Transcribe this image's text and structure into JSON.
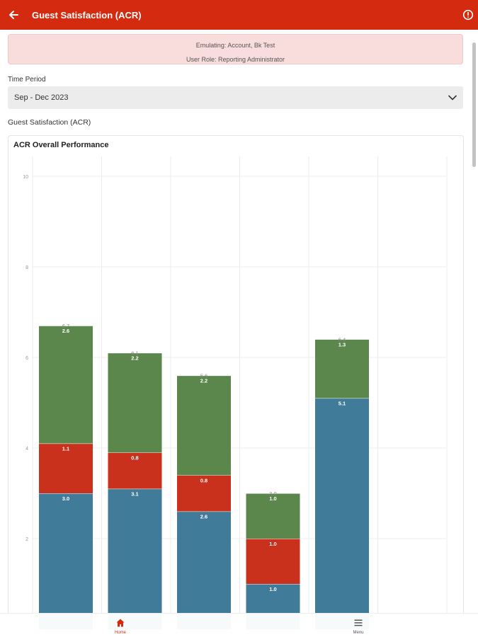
{
  "header": {
    "title": "Guest Satisfaction (ACR)",
    "back_icon": "arrow-left-icon",
    "info_icon": "info-icon"
  },
  "banner": {
    "emulating": "Emulating: Account, Bk Test",
    "role": "User Role: Reporting Administrator"
  },
  "filter": {
    "label": "Time Period",
    "value": "Sep - Dec 2023"
  },
  "section": {
    "title": "Guest Satisfaction (ACR)"
  },
  "chart_data": {
    "type": "bar",
    "stacked": true,
    "title": "ACR Overall Performance",
    "xlabel": "",
    "ylabel": "",
    "ylim": [
      0,
      10
    ],
    "yticks": [
      "10",
      "8",
      "6",
      "4",
      "2"
    ],
    "grid": true,
    "colors": {
      "series_blue": "#417b9a",
      "series_red": "#c9311c",
      "series_green": "#5b874c"
    },
    "series": [
      {
        "values": [
          3.0,
          3.1,
          2.6,
          1.0,
          5.1
        ],
        "labels": [
          "3.0",
          "3.1",
          "2.6",
          "1.0",
          "5.1"
        ]
      },
      {
        "values": [
          1.1,
          0.8,
          0.8,
          1.0,
          0
        ],
        "labels": [
          "1.1",
          "0.8",
          "0.8",
          "1.0",
          ""
        ]
      },
      {
        "values": [
          2.6,
          2.2,
          2.2,
          1.0,
          1.3
        ],
        "labels": [
          "2.6",
          "2.2",
          "2.2",
          "1.0",
          "1.3"
        ]
      }
    ],
    "totals": [
      "6.7",
      "6.1",
      "5.6",
      "3.0",
      "6.4"
    ]
  },
  "bottom_nav": {
    "home": {
      "label": "Home",
      "icon": "home-icon"
    },
    "menu": {
      "label": "Menu",
      "icon": "hamburger-menu-icon"
    }
  }
}
